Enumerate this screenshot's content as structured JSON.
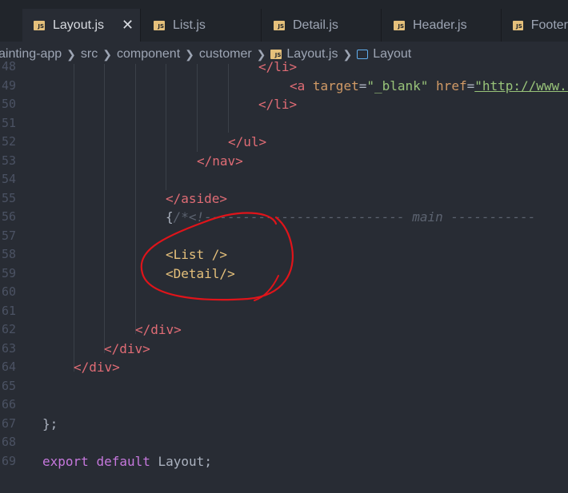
{
  "tabs": [
    {
      "label": "Layout.js",
      "icon": "JS",
      "active": true,
      "close": "✕"
    },
    {
      "label": "List.js",
      "icon": "JS"
    },
    {
      "label": "Detail.js",
      "icon": "JS"
    },
    {
      "label": "Header.js",
      "icon": "JS"
    },
    {
      "label": "Footer",
      "icon": "JS"
    }
  ],
  "breadcrumb": {
    "p1": "ainting-app",
    "p2": "src",
    "p3": "component",
    "p4": "customer",
    "p5": "Layout.js",
    "p6": "Layout"
  },
  "line_numbers": [
    "48",
    "49",
    "50",
    "51",
    "52",
    "53",
    "54",
    "55",
    "56",
    "57",
    "58",
    "59",
    "60",
    "61",
    "62",
    "63",
    "64",
    "65",
    "66",
    "67",
    "68",
    "69"
  ],
  "code": {
    "l48": "</li>",
    "l49_tag": "<a",
    "l49_attr1": "target",
    "l49_val1": "\"_blank\"",
    "l49_attr2": "href",
    "l49_val2": "\"http://www.r",
    "l50": "</li>",
    "l52": "</ul>",
    "l53": "</nav>",
    "l55": "</aside>",
    "l56_brace": "{",
    "l56_comment": "/*<!-------------------------- main -----------",
    "l58": "<List />",
    "l59": "<Detail/>",
    "l62": "</div>",
    "l63": "</div>",
    "l64": "</div>",
    "l67": "};",
    "l69_k1": "export",
    "l69_k2": "default",
    "l69_rest": "Layout;"
  },
  "colors": {
    "background": "#282c34",
    "tag": "#e06c75",
    "string": "#98c379",
    "keyword": "#c678dd",
    "annotation": "#e0141a"
  }
}
